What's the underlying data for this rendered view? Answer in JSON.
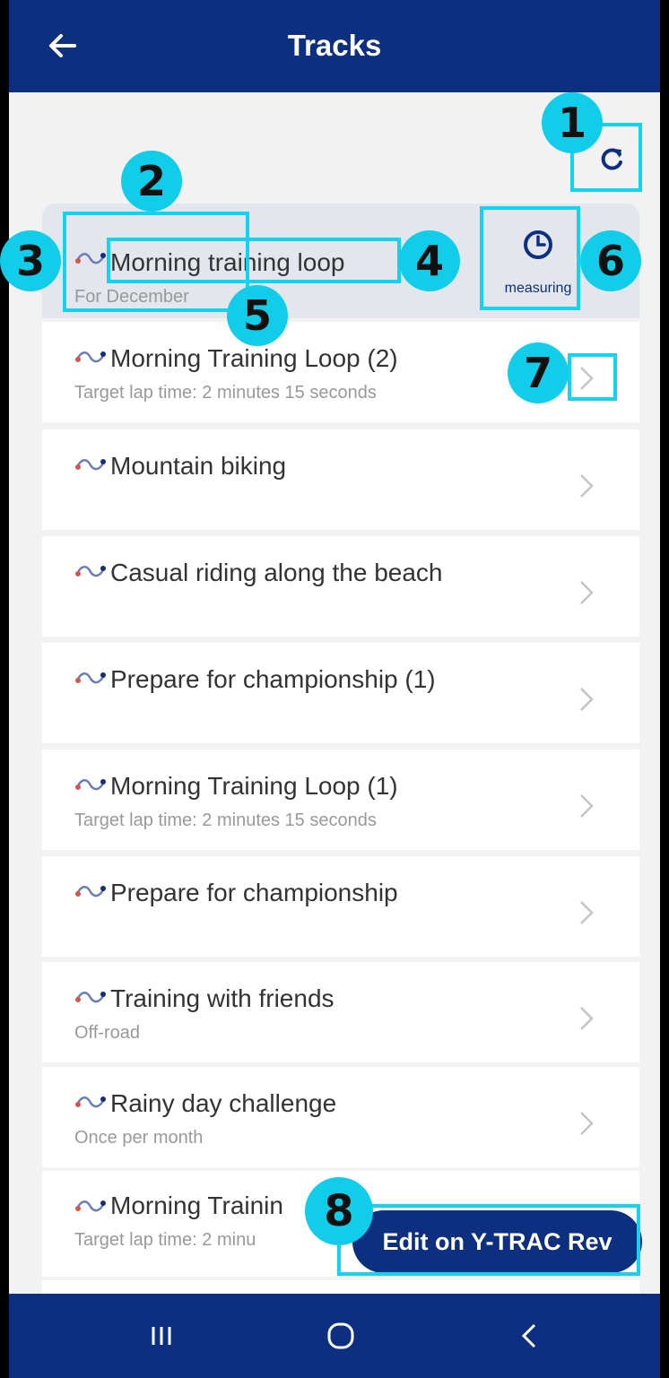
{
  "app": {
    "title": "Tracks"
  },
  "header": {
    "refresh_icon": "refresh-icon",
    "back_icon": "arrow-left-icon"
  },
  "active_track": {
    "title": "Morning training loop",
    "subtitle": "For December",
    "measure_label": "measuring",
    "measure_icon": "clock-icon"
  },
  "tracks": [
    {
      "title": "Morning Training Loop (2)",
      "subtitle": "Target lap time: 2 minutes 15 seconds"
    },
    {
      "title": "Mountain biking",
      "subtitle": ""
    },
    {
      "title": "Casual riding along the beach",
      "subtitle": ""
    },
    {
      "title": "Prepare for championship (1)",
      "subtitle": ""
    },
    {
      "title": "Morning Training Loop (1)",
      "subtitle": "Target lap time: 2 minutes 15 seconds"
    },
    {
      "title": "Prepare for championship",
      "subtitle": ""
    },
    {
      "title": "Training with friends",
      "subtitle": "Off-road"
    },
    {
      "title": "Rainy day challenge",
      "subtitle": "Once per month"
    },
    {
      "title": "Morning Trainin",
      "subtitle": "Target lap time: 2 minu"
    }
  ],
  "fab": {
    "label": "Edit on Y-TRAC Rev"
  },
  "annotations": [
    "1",
    "2",
    "3",
    "4",
    "5",
    "6",
    "7",
    "8"
  ],
  "colors": {
    "header": "#0d2f7f",
    "accent": "#12d3f2",
    "background": "#f2f2f2",
    "active_row": "#e3e6ec"
  }
}
